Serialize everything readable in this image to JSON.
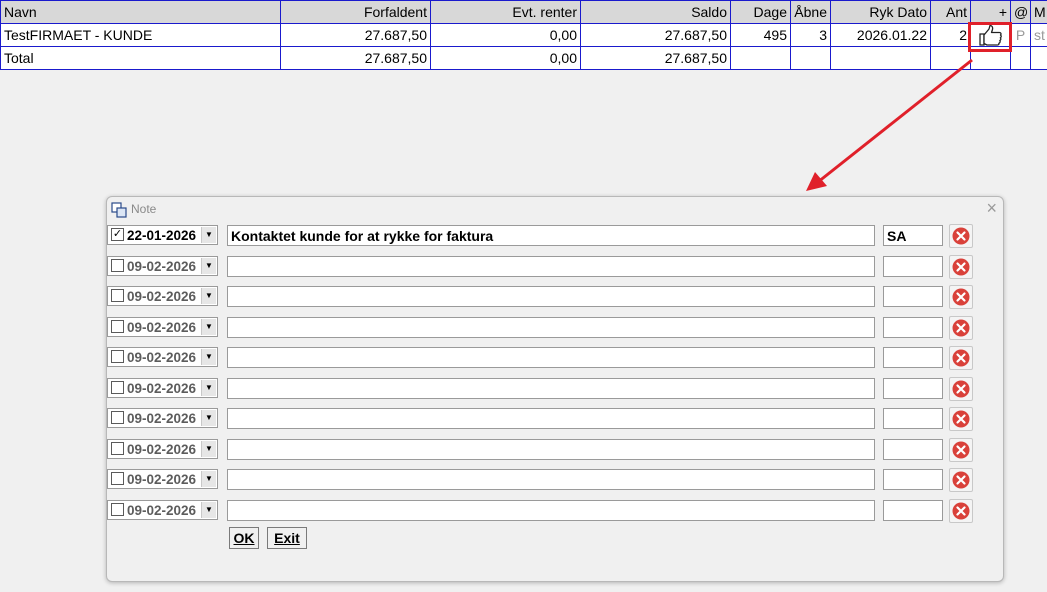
{
  "grid": {
    "headers": {
      "navn": "Navn",
      "forfaldent": "Forfaldent",
      "renter": "Evt. renter",
      "saldo": "Saldo",
      "dage": "Dage",
      "abne": "Åbne",
      "ryk_dato": "Ryk Dato",
      "ant": "Ant",
      "plus": "+",
      "at": "@",
      "m": "M"
    },
    "row": {
      "navn": "TestFIRMAET - KUNDE",
      "forfaldent": "27.687,50",
      "renter": "0,00",
      "saldo": "27.687,50",
      "dage": "495",
      "abne": "3",
      "ryk_dato": "2026.01.22",
      "ant": "2",
      "at": "P",
      "m": "st"
    },
    "total": {
      "navn": "Total",
      "forfaldent": "27.687,50",
      "renter": "0,00",
      "saldo": "27.687,50"
    },
    "note_icon": "thumbs-up-icon",
    "highlight_color": "#e0202a"
  },
  "dialog": {
    "title": "Note",
    "close_glyph": "×",
    "rows": [
      {
        "checked": true,
        "checkmark": "✓",
        "date": "22-01-2026",
        "text": "Kontaktet kunde for at rykke for faktura",
        "initials": "SA"
      },
      {
        "checked": false,
        "checkmark": "",
        "date": "09-02-2026",
        "text": "",
        "initials": ""
      },
      {
        "checked": false,
        "checkmark": "",
        "date": "09-02-2026",
        "text": "",
        "initials": ""
      },
      {
        "checked": false,
        "checkmark": "",
        "date": "09-02-2026",
        "text": "",
        "initials": ""
      },
      {
        "checked": false,
        "checkmark": "",
        "date": "09-02-2026",
        "text": "",
        "initials": ""
      },
      {
        "checked": false,
        "checkmark": "",
        "date": "09-02-2026",
        "text": "",
        "initials": ""
      },
      {
        "checked": false,
        "checkmark": "",
        "date": "09-02-2026",
        "text": "",
        "initials": ""
      },
      {
        "checked": false,
        "checkmark": "",
        "date": "09-02-2026",
        "text": "",
        "initials": ""
      },
      {
        "checked": false,
        "checkmark": "",
        "date": "09-02-2026",
        "text": "",
        "initials": ""
      },
      {
        "checked": false,
        "checkmark": "",
        "date": "09-02-2026",
        "text": "",
        "initials": ""
      }
    ],
    "dropdown_glyph": "▼",
    "ok_label": "OK",
    "exit_label": "Exit",
    "delete_icon": "delete-icon",
    "delete_color": "#d9413a"
  }
}
